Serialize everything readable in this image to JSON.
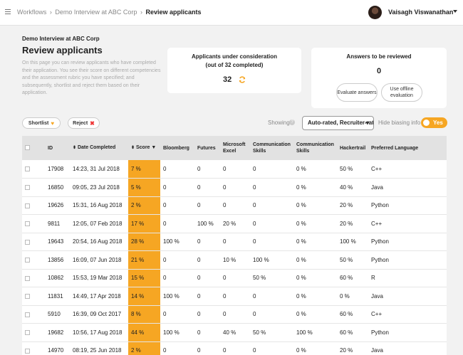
{
  "breadcrumb": {
    "items": [
      "Workflows",
      "Demo Interview at ABC Corp"
    ],
    "current": "Review applicants",
    "separator": "›"
  },
  "user": {
    "name": "Vaisagh Viswanathan"
  },
  "page": {
    "subtitle": "Demo Interview at ABC Corp",
    "title": "Review applicants",
    "description": "On this page you can review applicants who have completed their application. You see their score on different competencies and the assessment rubric you have specified; and subsequently, shortlist and reject them based on their application."
  },
  "applicants_card": {
    "title_line1": "Applicants under consideration",
    "title_line2": "(out of 32 completed)",
    "count": "32"
  },
  "answers_card": {
    "title": "Answers to be reviewed",
    "count": "0",
    "btn_eval": "Evaluate answers",
    "btn_offline": "Use offline evaluation"
  },
  "actions": {
    "shortlist": "Shortlist",
    "reject": "Reject"
  },
  "filters": {
    "showing_label": "Showing",
    "select_value": "Auto-rated, Recruiter-rated",
    "hide_bias_label": "Hide biasing info",
    "toggle_label": "Yes"
  },
  "colors": {
    "accent": "#f6a623",
    "reject": "#e33333"
  },
  "table": {
    "headers": [
      "ID",
      "Date Completed",
      "Score",
      "Bloomberg",
      "Futures",
      "Microsoft Excel",
      "Communication Skills",
      "Communication Skills",
      "Hackertrail",
      "Preferred Language"
    ],
    "rows": [
      [
        "17908",
        "14:23, 31 Jul 2018",
        "7 %",
        "0",
        "0",
        "0",
        "0",
        "0 %",
        "50 %",
        "C++"
      ],
      [
        "16850",
        "09:05, 23 Jul 2018",
        "5 %",
        "0",
        "0",
        "0",
        "0",
        "0 %",
        "40 %",
        "Java"
      ],
      [
        "19626",
        "15:31, 16 Aug 2018",
        "2 %",
        "0",
        "0",
        "0",
        "0",
        "0 %",
        "20 %",
        "Python"
      ],
      [
        "9811",
        "12:05, 07 Feb 2018",
        "17 %",
        "0",
        "100 %",
        "20 %",
        "0",
        "0 %",
        "20 %",
        "C++"
      ],
      [
        "19643",
        "20:54, 16 Aug 2018",
        "28 %",
        "100 %",
        "0",
        "0",
        "0",
        "0 %",
        "100 %",
        "Python"
      ],
      [
        "13856",
        "16:09, 07 Jun 2018",
        "21 %",
        "0",
        "0",
        "10 %",
        "100 %",
        "0 %",
        "50 %",
        "Python"
      ],
      [
        "10862",
        "15:53, 19 Mar 2018",
        "15 %",
        "0",
        "0",
        "0",
        "50 %",
        "0 %",
        "60 %",
        "R"
      ],
      [
        "11831",
        "14:49, 17 Apr 2018",
        "14 %",
        "100 %",
        "0",
        "0",
        "0",
        "0 %",
        "0 %",
        "Java"
      ],
      [
        "5910",
        "16:39, 09 Oct 2017",
        "8 %",
        "0",
        "0",
        "0",
        "0",
        "0 %",
        "60 %",
        "C++"
      ],
      [
        "19682",
        "10:56, 17 Aug 2018",
        "44 %",
        "100 %",
        "0",
        "40 %",
        "50 %",
        "100 %",
        "60 %",
        "Python"
      ],
      [
        "14970",
        "08:19, 25 Jun 2018",
        "2 %",
        "0",
        "0",
        "0",
        "0",
        "0 %",
        "20 %",
        "Java"
      ]
    ]
  }
}
